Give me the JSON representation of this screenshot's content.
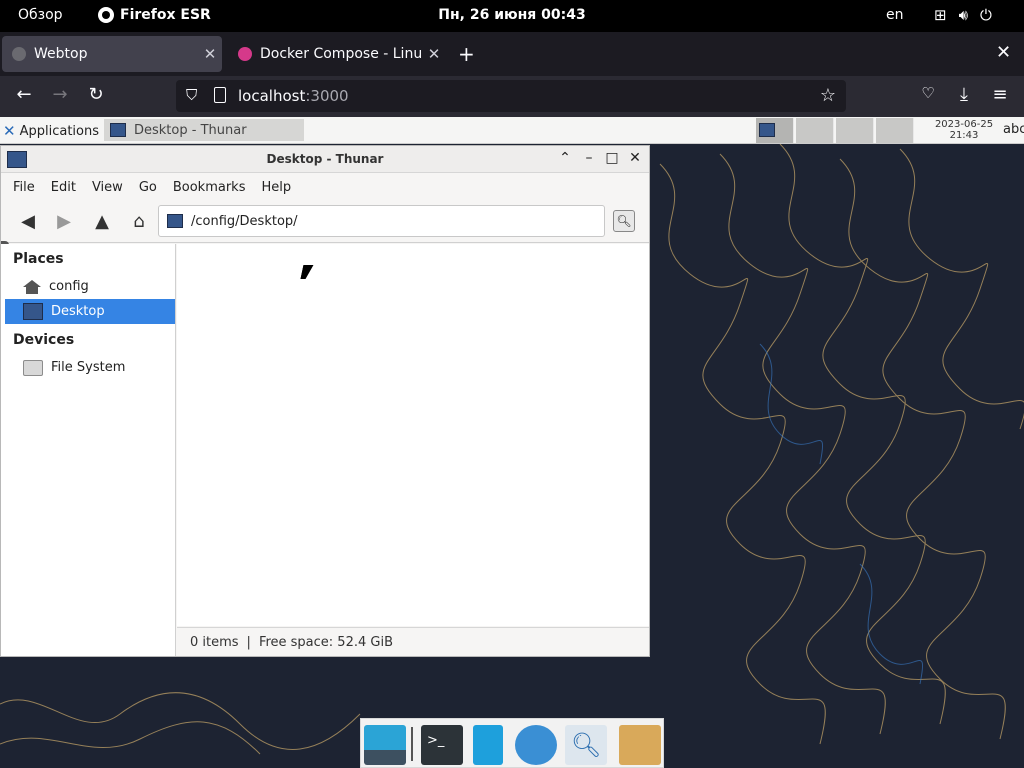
{
  "gnome_bar": {
    "overview_label": "Обзор",
    "app_label": "Firefox ESR",
    "clock": "Пн, 26 июня  00:43",
    "language": "en"
  },
  "firefox": {
    "tabs": [
      {
        "title": "Webtop"
      },
      {
        "title": "Docker Compose - LinuxServer"
      }
    ],
    "new_tab_glyph": "+",
    "close_glyph": "✕",
    "url_host": "localhost",
    "url_port": ":3000"
  },
  "xfce_panel": {
    "applications_label": "Applications",
    "task_title": "Desktop - Thunar",
    "date": "2023-06-25",
    "time": "21:43",
    "keyboard": "abc"
  },
  "thunar": {
    "title": "Desktop - Thunar",
    "menu": [
      "File",
      "Edit",
      "View",
      "Go",
      "Bookmarks",
      "Help"
    ],
    "location": "/config/Desktop/",
    "sidebar": {
      "places_header": "Places",
      "places": [
        {
          "label": "config",
          "icon": "home-folder-icon"
        },
        {
          "label": "Desktop",
          "icon": "desktop-icon",
          "selected": true
        }
      ],
      "devices_header": "Devices",
      "devices": [
        {
          "label": "File System",
          "icon": "drive-icon"
        }
      ]
    },
    "status": {
      "items": "0 items",
      "separator": "|",
      "free_space": "Free space: 52.4 GiB"
    }
  },
  "dock": {
    "icons": [
      "show-desktop-icon",
      "terminal-icon",
      "file-manager-icon",
      "web-browser-icon",
      "app-finder-icon",
      "folder-icon"
    ]
  },
  "colors": {
    "selection": "#3584e4",
    "wallpaper": "#1d2332"
  }
}
